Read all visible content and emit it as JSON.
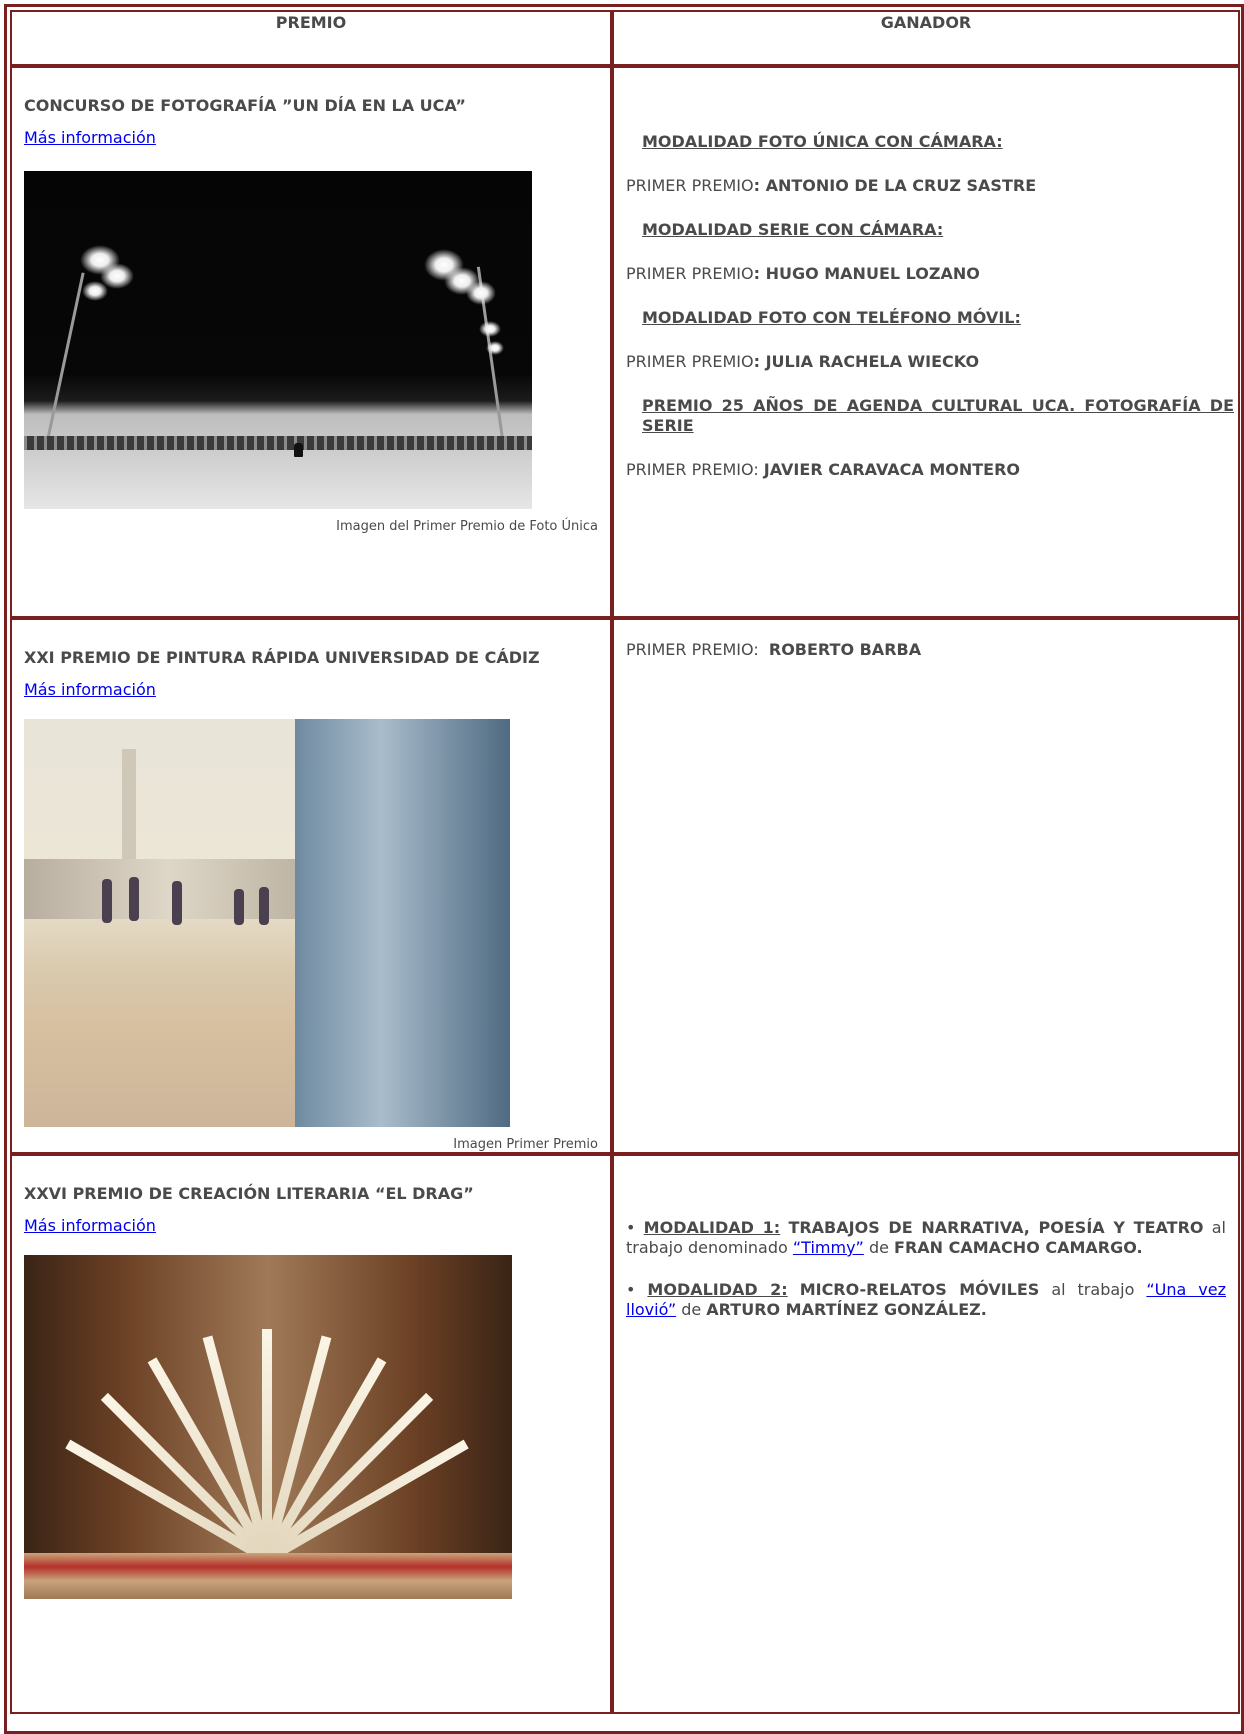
{
  "table": {
    "headers": {
      "left": "PREMIO",
      "right": "GANADOR"
    },
    "rows": [
      {
        "title": "CONCURSO DE FOTOGRAFÍA ”UN DÍA EN LA UCA”",
        "link": "Más información",
        "caption": "Imagen del Primer Premio de Foto Única",
        "entries": [
          {
            "modality": "MODALIDAD FOTO ÚNICA CON CÁMARA",
            "modality_suffix": ":",
            "prize_label": "PRIMER PREMIO",
            "prize_sep": ": ",
            "winner": "ANTONIO DE LA CRUZ SASTRE"
          },
          {
            "modality": "MODALIDAD SERIE CON CÁMARA",
            "modality_suffix": ":",
            "prize_label": "PRIMER PREMIO",
            "prize_sep": ": ",
            "winner": "HUGO MANUEL LOZANO"
          },
          {
            "modality": "MODALIDAD FOTO CON TELÉFONO MÓVIL",
            "modality_suffix": ":",
            "prize_label": "PRIMER PREMIO",
            "prize_sep": ": ",
            "winner": "JULIA RACHELA WIECKO"
          },
          {
            "modality": "PREMIO 25 AÑOS DE AGENDA CULTURAL UCA. FOTOGRAFÍA DE SERIE",
            "modality_suffix": "",
            "prize_label": "PRIMER PREMIO",
            "prize_sep": ": ",
            "winner": "JAVIER CARAVACA MONTERO"
          }
        ]
      },
      {
        "title": "XXI PREMIO DE PINTURA RÁPIDA UNIVERSIDAD DE CÁDIZ",
        "link": "Más información",
        "caption": "Imagen Primer Premio",
        "prize_label": "PRIMER PREMIO:",
        "winner": "ROBERTO BARBA"
      },
      {
        "title": "XXVI PREMIO DE CREACIÓN LITERARIA “EL DRAG”",
        "link": "Más información",
        "m1": {
          "bullet": "•",
          "label": "MODALIDAD 1:",
          "category": "TRABAJOS DE NARRATIVA, POESÍA Y TEATRO",
          "text1": "al trabajo denominado",
          "work": "“Timmy”",
          "text2": "de",
          "author": "FRAN CAMACHO CAMARGO."
        },
        "m2": {
          "bullet": "•",
          "label": "MODALIDAD 2:",
          "category": "MICRO-RELATOS MÓVILES",
          "text1": "al trabajo",
          "work": "“Una vez llovió”",
          "text2": "de",
          "author": "ARTURO MARTÍNEZ GONZÁLEZ."
        }
      }
    ]
  },
  "colors": {
    "border": "#7a1f1f",
    "text": "#4a4a4a",
    "link": "#0000ee"
  }
}
